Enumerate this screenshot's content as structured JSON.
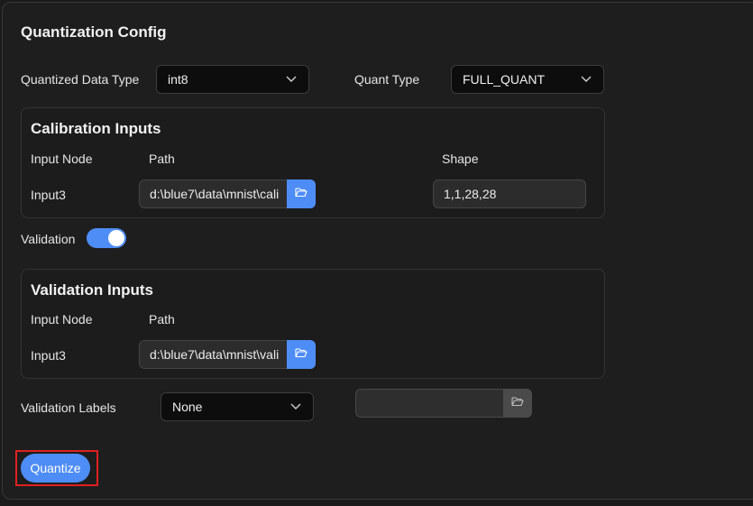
{
  "config": {
    "title": "Quantization Config",
    "data_type_label": "Quantized Data Type",
    "data_type_value": "int8",
    "quant_type_label": "Quant Type",
    "quant_type_value": "FULL_QUANT"
  },
  "calibration": {
    "title": "Calibration Inputs",
    "headers": {
      "node": "Input Node",
      "path": "Path",
      "shape": "Shape"
    },
    "row": {
      "node": "Input3",
      "path": "d:\\blue7\\data\\mnist\\cali",
      "shape": "1,1,28,28"
    }
  },
  "validation_toggle": {
    "label": "Validation",
    "enabled": true
  },
  "validation": {
    "title": "Validation Inputs",
    "headers": {
      "node": "Input Node",
      "path": "Path"
    },
    "row": {
      "node": "Input3",
      "path": "d:\\blue7\\data\\mnist\\vali"
    }
  },
  "labels": {
    "label": "Validation Labels",
    "value": "None",
    "path": ""
  },
  "actions": {
    "quantize_label": "Quantize"
  },
  "colors": {
    "accent": "#4e8df5",
    "highlight": "#e02020"
  },
  "icons": {
    "folder": "folder-open-icon",
    "chevron": "chevron-down-icon"
  }
}
